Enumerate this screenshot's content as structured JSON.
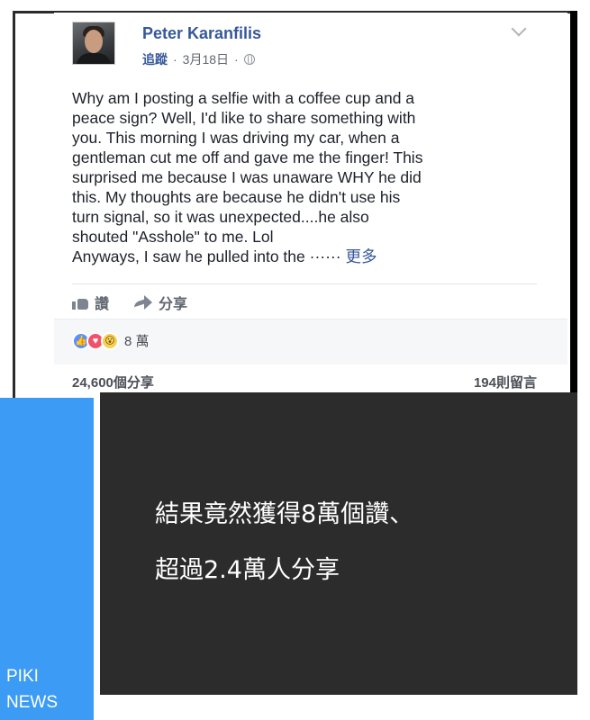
{
  "post": {
    "author": "Peter Karanfilis",
    "follow_label": "追蹤",
    "separator": "·",
    "date": "3月18日",
    "text_lines": [
      "Why am I posting a selfie with a coffee cup and a",
      "peace sign? Well, I'd like to share something with",
      "you. This morning I was driving my car, when a",
      "gentleman cut me off and gave me the finger! This",
      "surprised me because I was unaware WHY he did",
      "this. My thoughts are because he didn't use his",
      "turn signal, so it was unexpected....he also",
      "shouted \"Asshole\" to me. Lol",
      "Anyways, I saw he pulled into the ······"
    ],
    "see_more": "更多",
    "actions": {
      "like": "讚",
      "share": "分享"
    },
    "reactions": {
      "count": "8 萬"
    },
    "shares": "24,600個分享",
    "comments": "194則留言"
  },
  "caption": {
    "line1": "結果竟然獲得8萬個讚、",
    "line2": "超過2.4萬人分享"
  },
  "brand": {
    "line1": "PIKI",
    "line2": "NEWS"
  },
  "colors": {
    "link_blue": "#365899",
    "brand_blue": "#3b9bf5",
    "caption_bg": "#2c2c2c"
  },
  "icons": [
    "globe-icon",
    "chevron-down-icon",
    "like-icon",
    "share-icon",
    "like-reaction-icon",
    "love-reaction-icon",
    "wow-reaction-icon"
  ]
}
